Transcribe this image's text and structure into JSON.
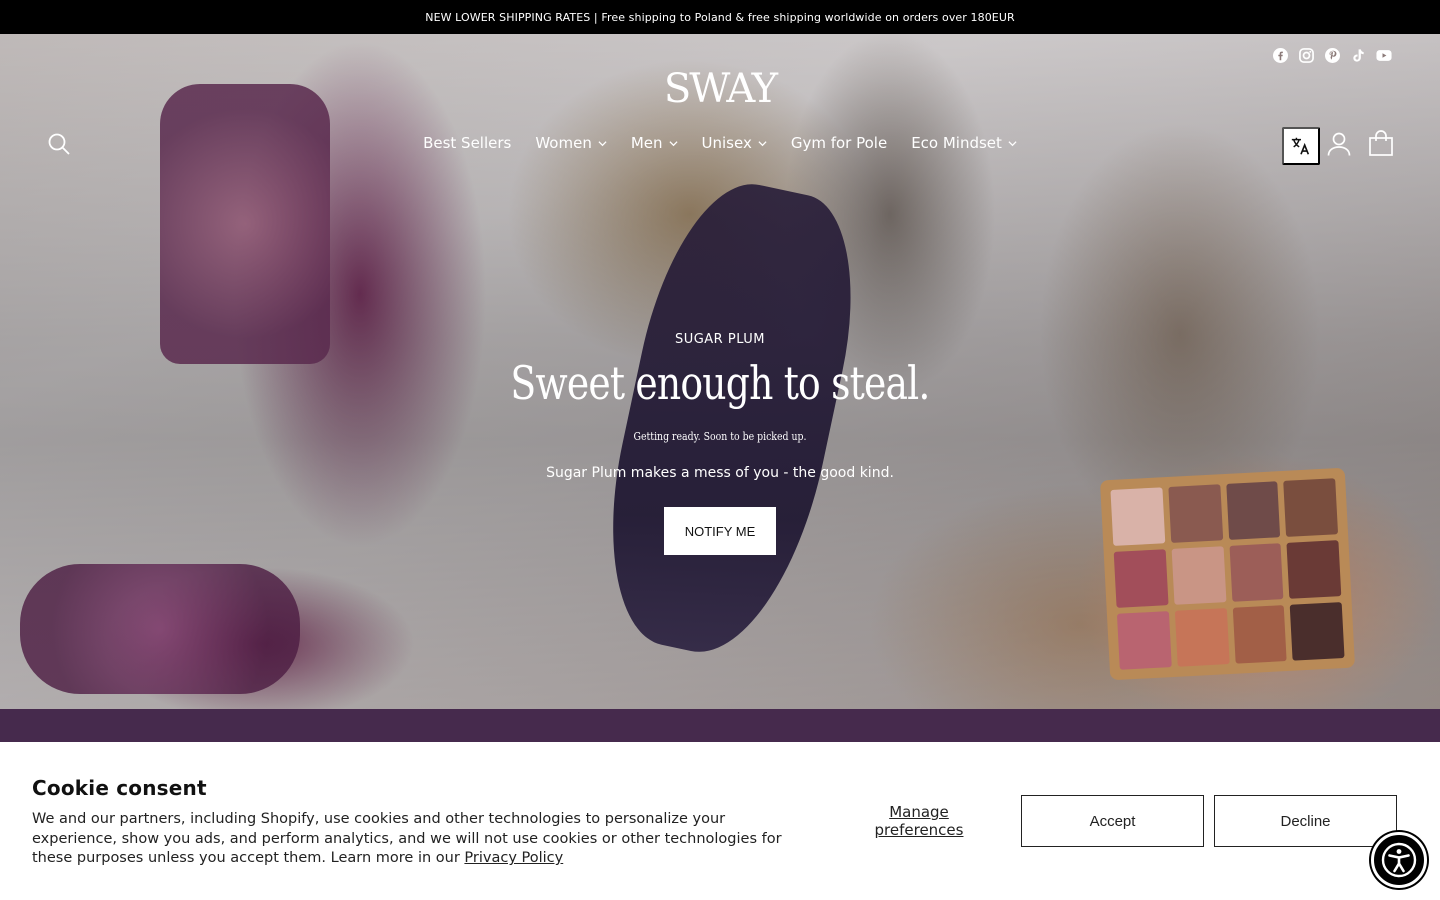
{
  "announcement": {
    "text": "NEW LOWER SHIPPING RATES | Free shipping to Poland & free shipping worldwide on orders over 180EUR"
  },
  "header": {
    "logo": "SWAY",
    "social": [
      "facebook-icon",
      "instagram-icon",
      "pinterest-icon",
      "tiktok-icon",
      "youtube-icon"
    ],
    "nav": [
      {
        "label": "Best Sellers",
        "dropdown": false
      },
      {
        "label": "Women",
        "dropdown": true
      },
      {
        "label": "Men",
        "dropdown": true
      },
      {
        "label": "Unisex",
        "dropdown": true
      },
      {
        "label": "Gym for Pole",
        "dropdown": false
      },
      {
        "label": "Eco Mindset",
        "dropdown": true
      }
    ]
  },
  "hero": {
    "eyebrow": "SUGAR PLUM",
    "headline": "Sweet enough to steal.",
    "subheadline": "Getting ready. Soon to be picked up.",
    "description": "Sugar Plum makes a mess of you - the good kind.",
    "cta": "NOTIFY ME"
  },
  "strip": {
    "text": ""
  },
  "cookie": {
    "title": "Cookie consent",
    "text": "We and our partners, including Shopify, use cookies and other technologies to personalize your experience, show you ads, and perform analytics, and we will not use cookies or other technologies for these purposes unless you accept them. Learn more in our",
    "link": "Privacy Policy",
    "manage": "Manage preferences",
    "accept": "Accept",
    "decline": "Decline"
  },
  "colors": {
    "strip": "#462a4d",
    "announcement": "#000000"
  }
}
